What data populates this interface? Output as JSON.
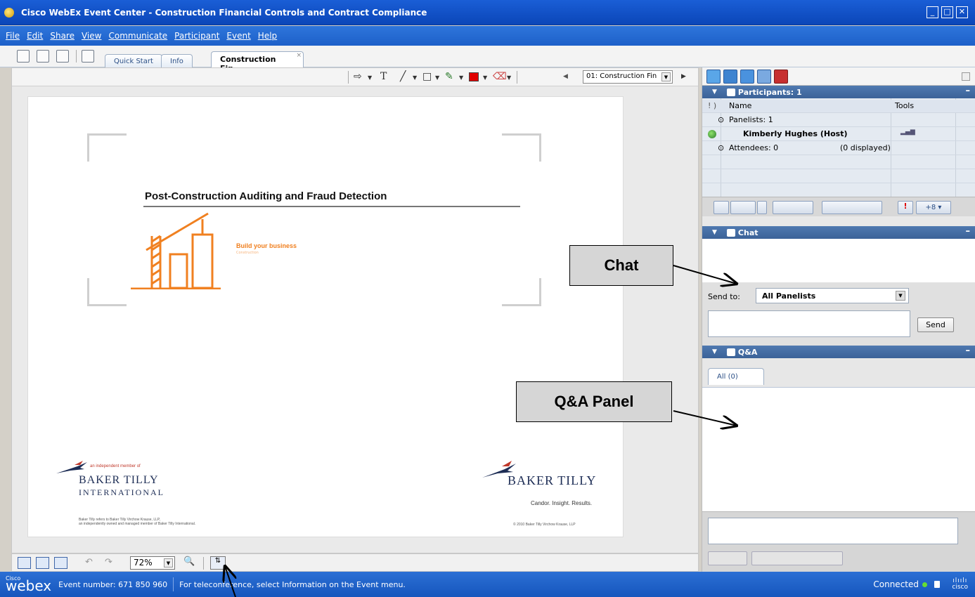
{
  "window": {
    "title": "Cisco WebEx Event Center - Construction Financial Controls and Contract Compliance",
    "buttons": [
      "minimize",
      "maximize",
      "close"
    ]
  },
  "menu": [
    "File",
    "Edit",
    "Share",
    "View",
    "Communicate",
    "Participant",
    "Event",
    "Help"
  ],
  "tabs": {
    "quick_start": "Quick Start",
    "info": "Info",
    "active": "Construction Fin...",
    "close_glyph": "×"
  },
  "draw_toolbar": {
    "page_selector": "01: Construction Fin"
  },
  "slide": {
    "title": "Post-Construction Auditing and Fraud Detection",
    "build_text": "Build your business",
    "build_sub": "Construction",
    "left_logo": {
      "tagline": "an independent member of",
      "name": "BAKER TILLY",
      "subname": "INTERNATIONAL",
      "footnote_line1": "Baker Tilly refers to Baker Tilly Virchow Krause, LLP,",
      "footnote_line2": "an independently owned and managed member of Baker Tilly International."
    },
    "right_logo": {
      "name": "BAKER TILLY",
      "tag": "Candor. Insight. Results.",
      "copyright": "© 2010 Baker Tilly Virchow Krause, LLP"
    }
  },
  "view_toolbar": {
    "zoom": "72%"
  },
  "statusbar": {
    "logo_small": "Cisco",
    "logo": "webex",
    "event_number": "Event number: 671 850 960",
    "info": "For teleconference, select Information on the Event menu.",
    "connected": "Connected",
    "cisco": "cisco"
  },
  "participants": {
    "header": "Participants: 1",
    "col_name": "Name",
    "col_tools": "Tools",
    "panelists": "Panelists: 1",
    "host": "Kimberly Hughes (Host)",
    "attendees": "Attendees: 0",
    "displayed": "(0 displayed)"
  },
  "chat": {
    "header": "Chat",
    "send_to_label": "Send to:",
    "send_to_value": "All Panelists",
    "send_button": "Send"
  },
  "qa": {
    "header": "Q&A",
    "tab_all": "All (0)"
  },
  "annotations": {
    "chat_callout": "Chat",
    "qa_callout": "Q&A Panel"
  },
  "colors": {
    "title_bar": "#0b46b8",
    "panel_header": "#3b6298",
    "accent_orange": "#f08020",
    "status_green": "#66dd33"
  }
}
